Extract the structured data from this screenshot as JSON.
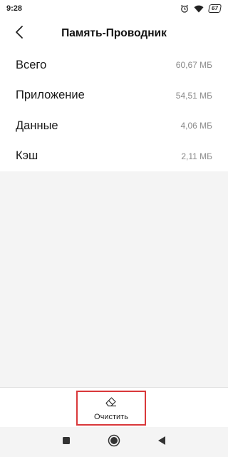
{
  "status_bar": {
    "time": "9:28",
    "battery": "67",
    "icons": [
      "alarm-icon",
      "wifi-icon",
      "battery-icon"
    ]
  },
  "app_bar": {
    "title": "Память-Проводник",
    "back_icon": "chevron-left-icon"
  },
  "storage_rows": [
    {
      "label": "Всего",
      "value": "60,67 МБ"
    },
    {
      "label": "Приложение",
      "value": "54,51 МБ"
    },
    {
      "label": "Данные",
      "value": "4,06 МБ"
    },
    {
      "label": "Кэш",
      "value": "2,11 МБ"
    }
  ],
  "bottom_bar": {
    "clear_label": "Очистить",
    "clear_icon": "eraser-icon",
    "highlight_color": "#d9383a"
  },
  "nav_bar": {
    "icons": [
      "recents-square-icon",
      "home-circle-icon",
      "back-triangle-icon"
    ]
  }
}
